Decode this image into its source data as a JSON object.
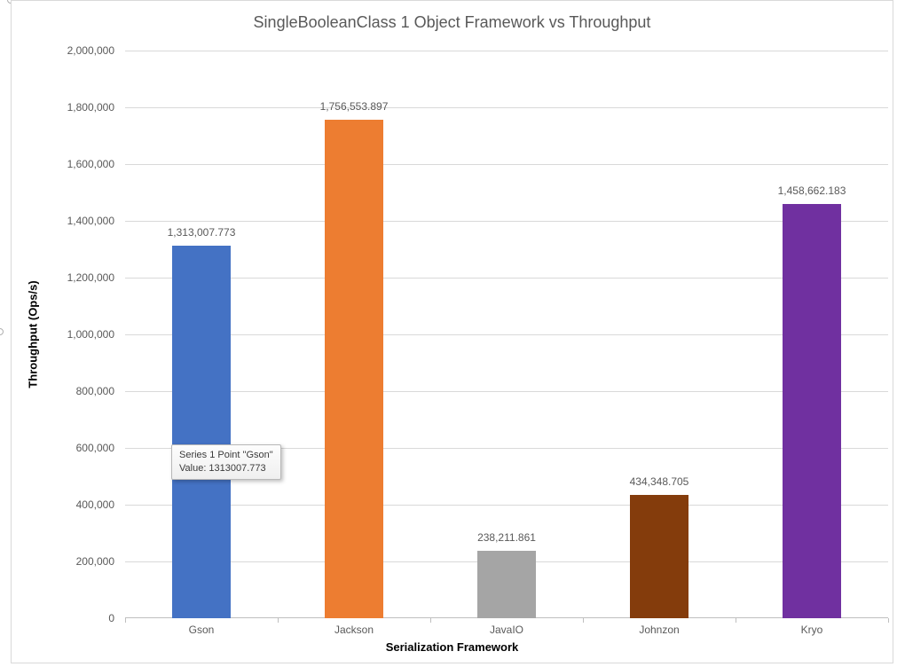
{
  "chart_data": {
    "type": "bar",
    "title": "SingleBooleanClass 1 Object Framework vs Throughput",
    "xlabel": "Serialization Framework",
    "ylabel": "Throughput (Ops/s)",
    "ylim": [
      0,
      2000000
    ],
    "y_ticks": [
      0,
      200000,
      400000,
      600000,
      800000,
      1000000,
      1200000,
      1400000,
      1600000,
      1800000,
      2000000
    ],
    "y_tick_labels": [
      "0",
      "200,000",
      "400,000",
      "600,000",
      "800,000",
      "1,000,000",
      "1,200,000",
      "1,400,000",
      "1,600,000",
      "1,800,000",
      "2,000,000"
    ],
    "categories": [
      "Gson",
      "Jackson",
      "JavaIO",
      "Johnzon",
      "Kryo"
    ],
    "values": [
      1313007.773,
      1756553.897,
      238211.861,
      434348.705,
      1458662.183
    ],
    "data_labels": [
      "1,313,007.773",
      "1,756,553.897",
      "238,211.861",
      "434,348.705",
      "1,458,662.183"
    ],
    "colors": [
      "#4472C4",
      "#ED7D31",
      "#A5A5A5",
      "#843C0C",
      "#7030A0"
    ]
  },
  "tooltip": {
    "line1": "Series 1 Point \"Gson\"",
    "line2": "Value: 1313007.773"
  }
}
